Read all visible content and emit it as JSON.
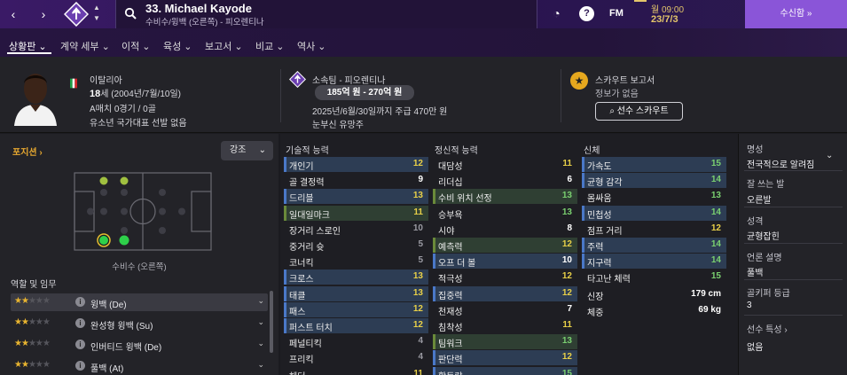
{
  "topbar": {
    "back_icon": "chevron-left-icon",
    "forward_icon": "chevron-right-icon",
    "player_title": "33. Michael Kayode",
    "player_sub": "수비수/윙백 (오른쪽) - 피오렌티나",
    "fm_label": "FM",
    "time": "월 09:00",
    "date": "23/7/3",
    "continue_label": "수신함  »"
  },
  "tabs": [
    {
      "label": "상황판 ⌄"
    },
    {
      "label": "계약 세부 ⌄"
    },
    {
      "label": "이적 ⌄"
    },
    {
      "label": "육성 ⌄"
    },
    {
      "label": "보고서 ⌄"
    },
    {
      "label": "비교 ⌄"
    },
    {
      "label": "역사 ⌄"
    }
  ],
  "profile": {
    "nation": "이탈리아",
    "age_num": "18",
    "age_text": "세 (2004년/7월/10일)",
    "a_caps": "A매치 0경기 / 0골",
    "youth_caps": "유소년 국가대표 선발 없음",
    "club": "소속팀 - 피오렌티나",
    "value_range": "185억 원 - 270억 원",
    "contract": "2025년/6월/30일까지 주급 470만 원",
    "status": "눈부신 유망주",
    "scout_title": "스카우트 보고서",
    "scout_info": "정보가 없음",
    "scout_button": "선수 스카우트"
  },
  "left": {
    "position_title": "포지션 ›",
    "emphasis_label": "강조",
    "pitch_caption": "수비수 (오른쪽)",
    "roles_title": "역할 및 임무",
    "roles": [
      {
        "name": "윙백 (De)",
        "stars": 2,
        "selected": true
      },
      {
        "name": "완성형 윙백 (Su)",
        "stars": 2,
        "selected": false
      },
      {
        "name": "인버티드 윙백 (De)",
        "stars": 2,
        "selected": false
      },
      {
        "name": "풀백 (At)",
        "stars": 2,
        "selected": false
      }
    ]
  },
  "attributes": {
    "technical_title": "기술적 능력",
    "mental_title": "정신적 능력",
    "physical_title": "신체",
    "technical": [
      {
        "name": "개인기",
        "value": "12"
      },
      {
        "name": "골 결정력",
        "value": "9"
      },
      {
        "name": "드리블",
        "value": "13"
      },
      {
        "name": "일대일마크",
        "value": "11"
      },
      {
        "name": "장거리 스로인",
        "value": "10"
      },
      {
        "name": "중거리 슛",
        "value": "5"
      },
      {
        "name": "코너킥",
        "value": "5"
      },
      {
        "name": "크로스",
        "value": "13"
      },
      {
        "name": "태클",
        "value": "13"
      },
      {
        "name": "패스",
        "value": "12"
      },
      {
        "name": "퍼스트 터치",
        "value": "12"
      },
      {
        "name": "페널티킥",
        "value": "4"
      },
      {
        "name": "프리킥",
        "value": "4"
      },
      {
        "name": "헤더",
        "value": "11"
      }
    ],
    "mental": [
      {
        "name": "대담성",
        "value": "11"
      },
      {
        "name": "리더십",
        "value": "6"
      },
      {
        "name": "수비 위치 선정",
        "value": "13"
      },
      {
        "name": "승부욕",
        "value": "13"
      },
      {
        "name": "시야",
        "value": "8"
      },
      {
        "name": "예측력",
        "value": "12"
      },
      {
        "name": "오프 더 볼",
        "value": "10"
      },
      {
        "name": "적극성",
        "value": "12"
      },
      {
        "name": "집중력",
        "value": "12"
      },
      {
        "name": "천재성",
        "value": "7"
      },
      {
        "name": "침착성",
        "value": "11"
      },
      {
        "name": "팀워크",
        "value": "13"
      },
      {
        "name": "판단력",
        "value": "12"
      },
      {
        "name": "활동량",
        "value": "15"
      }
    ],
    "physical": [
      {
        "name": "가속도",
        "value": "15"
      },
      {
        "name": "균형 감각",
        "value": "14"
      },
      {
        "name": "몸싸움",
        "value": "13"
      },
      {
        "name": "민첩성",
        "value": "14"
      },
      {
        "name": "점프 거리",
        "value": "12"
      },
      {
        "name": "주력",
        "value": "14"
      },
      {
        "name": "지구력",
        "value": "14"
      },
      {
        "name": "타고난 체력",
        "value": "15"
      }
    ],
    "height_label": "신장",
    "height_value": "179 cm",
    "weight_label": "체중",
    "weight_value": "69 kg"
  },
  "right": {
    "fame_label": "명성",
    "fame_value": "전국적으로 알려짐",
    "foot_label": "잘 쓰는 발",
    "foot_value": "오른발",
    "personality_label": "성격",
    "personality_value": "균형잡힌",
    "media_label": "언론 설명",
    "media_value": "풀백",
    "gk_label": "골키퍼 등급",
    "gk_value": "3",
    "traits_label": "선수 특성 ›",
    "traits_value": "없음"
  },
  "colors": {
    "accent": "#8a55d8",
    "orange": "#e6a830",
    "date": "#e3c56a",
    "highlight_blue": "#2d3d54",
    "highlight_green": "#2f3f33"
  }
}
